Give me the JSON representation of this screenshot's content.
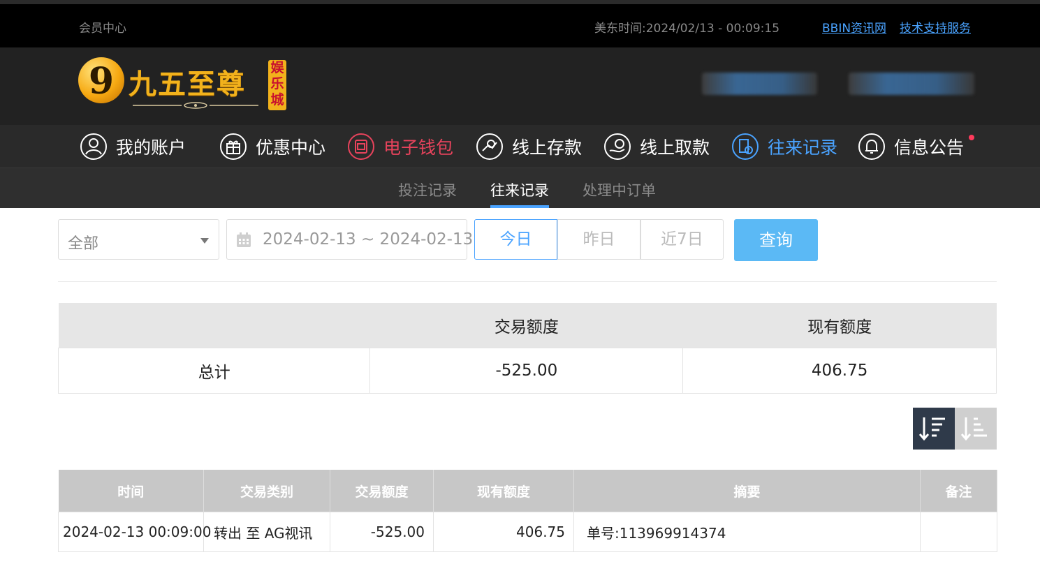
{
  "topbar": {
    "member_center": "会员中心",
    "time_label": "美东时间:",
    "time_value": "2024/02/13 - 00:09:15",
    "link_bbin": "BBIN资讯网",
    "link_support": "技术支持服务"
  },
  "logo": {
    "digit": "9",
    "text": "九五至尊",
    "badge": [
      "娱",
      "乐",
      "城"
    ]
  },
  "nav": {
    "items": [
      {
        "label": "我的账户",
        "icon": "user-icon"
      },
      {
        "label": "优惠中心",
        "icon": "gift-icon"
      },
      {
        "label": "电子钱包",
        "icon": "wallet-icon"
      },
      {
        "label": "线上存款",
        "icon": "deposit-icon"
      },
      {
        "label": "线上取款",
        "icon": "withdraw-icon"
      },
      {
        "label": "往来记录",
        "icon": "records-icon"
      },
      {
        "label": "信息公告",
        "icon": "bell-icon"
      }
    ]
  },
  "subnav": {
    "tabs": [
      "投注记录",
      "往来记录",
      "处理中订单"
    ]
  },
  "filters": {
    "type_selected": "全部",
    "date_range": "2024-02-13 ~ 2024-02-13",
    "quick": [
      "今日",
      "昨日",
      "近7日"
    ],
    "search_label": "查询"
  },
  "summary": {
    "headers": [
      "",
      "交易额度",
      "现有额度"
    ],
    "row": [
      "总计",
      "-525.00",
      "406.75"
    ]
  },
  "detail": {
    "headers": [
      "时间",
      "交易类别",
      "交易额度",
      "现有额度",
      "摘要",
      "备注"
    ],
    "rows": [
      [
        "2024-02-13 00:09:00",
        "转出 至 AG视讯",
        "-525.00",
        "406.75",
        "单号:113969914374",
        ""
      ]
    ]
  },
  "colors": {
    "accent": "#4aa3ff",
    "wallet_red": "#e8435c",
    "search_button": "#5bb9f5",
    "logo_gold": "#f2b21c"
  }
}
